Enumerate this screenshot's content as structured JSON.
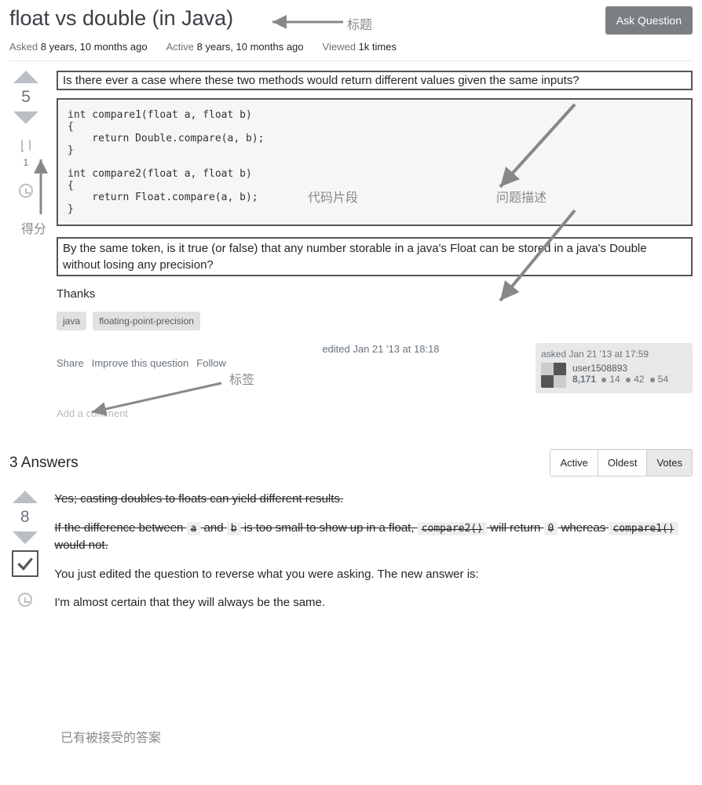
{
  "header": {
    "title": "float vs double (in Java)",
    "ask_button": "Ask Question"
  },
  "meta": {
    "asked_label": "Asked",
    "asked_value": "8 years, 10 months ago",
    "active_label": "Active",
    "active_value": "8 years, 10 months ago",
    "viewed_label": "Viewed",
    "viewed_value": "1k times"
  },
  "question": {
    "score": "5",
    "bookmark_count": "1",
    "intro": "Is there ever a case where these two methods would return different values given the same inputs?",
    "code": "int compare1(float a, float b)\n{\n    return Double.compare(a, b);\n}\n\nint compare2(float a, float b)\n{\n    return Float.compare(a, b);\n}",
    "followup": "By the same token, is it true (or false) that any number storable in a java's Float can be stored in a java's Double without losing any precision?",
    "thanks": "Thanks",
    "tags": [
      "java",
      "floating-point-precision"
    ],
    "actions": {
      "share": "Share",
      "improve": "Improve this question",
      "follow": "Follow"
    },
    "edited": "edited Jan 21 '13 at 18:18",
    "author": {
      "asked": "asked Jan 21 '13 at 17:59",
      "name": "user1508893",
      "rep": "8,171",
      "gold": "14",
      "silver": "42",
      "bronze": "54"
    },
    "add_comment": "Add a comment"
  },
  "answers": {
    "heading": "3 Answers",
    "sort": {
      "active": "Active",
      "oldest": "Oldest",
      "votes": "Votes"
    },
    "top": {
      "score": "8",
      "line1": "Yes; casting doubles to floats can yield different results.",
      "line2_a": "If the difference between ",
      "code_a": "a",
      "line2_b": " and ",
      "code_b": "b",
      "line2_c": " is too small to show up in a float, ",
      "code_c": "compare2()",
      "line2_d": " will return ",
      "code_d": "0",
      "line2_e": " whereas ",
      "code_e": "compare1()",
      "line2_f": " would not.",
      "edit_note": "You just edited the question to reverse what you were asking. The new answer is:",
      "line3": "I'm almost certain that they will always be the same."
    }
  },
  "annotations": {
    "title": "标题",
    "code_snippet": "代码片段",
    "problem_desc": "问题描述",
    "score": "得分",
    "tags": "标签",
    "accepted": "已有被接受的答案"
  }
}
